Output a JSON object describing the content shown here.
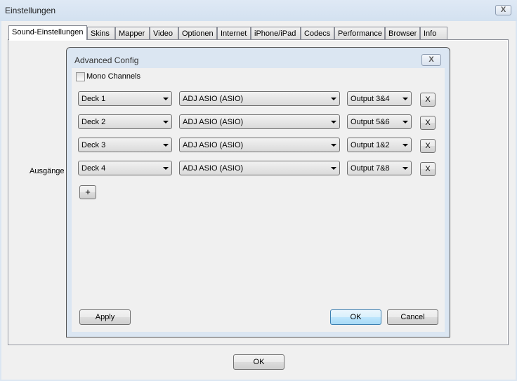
{
  "window": {
    "title": "Einstellungen",
    "close": "X"
  },
  "tabs": [
    "Sound-Einstellungen",
    "Skins",
    "Mapper",
    "Video",
    "Optionen",
    "Internet",
    "iPhone/iPad",
    "Codecs",
    "Performance",
    "Browser",
    "Info"
  ],
  "panel": {
    "outputs_label": "Ausgänge"
  },
  "dialog": {
    "title": "Advanced Config",
    "close": "X",
    "mono_channels": {
      "label": "Mono Channels",
      "checked": false
    },
    "rows": [
      {
        "deck": "Deck 1",
        "device": "ADJ ASIO (ASIO)",
        "output": "Output 3&4",
        "remove": "X"
      },
      {
        "deck": "Deck 2",
        "device": "ADJ ASIO (ASIO)",
        "output": "Output 5&6",
        "remove": "X"
      },
      {
        "deck": "Deck 3",
        "device": "ADJ ASIO (ASIO)",
        "output": "Output 1&2",
        "remove": "X"
      },
      {
        "deck": "Deck 4",
        "device": "ADJ ASIO (ASIO)",
        "output": "Output 7&8",
        "remove": "X"
      }
    ],
    "add": "+",
    "apply": "Apply",
    "ok": "OK",
    "cancel": "Cancel"
  },
  "footer": {
    "ok": "OK"
  }
}
